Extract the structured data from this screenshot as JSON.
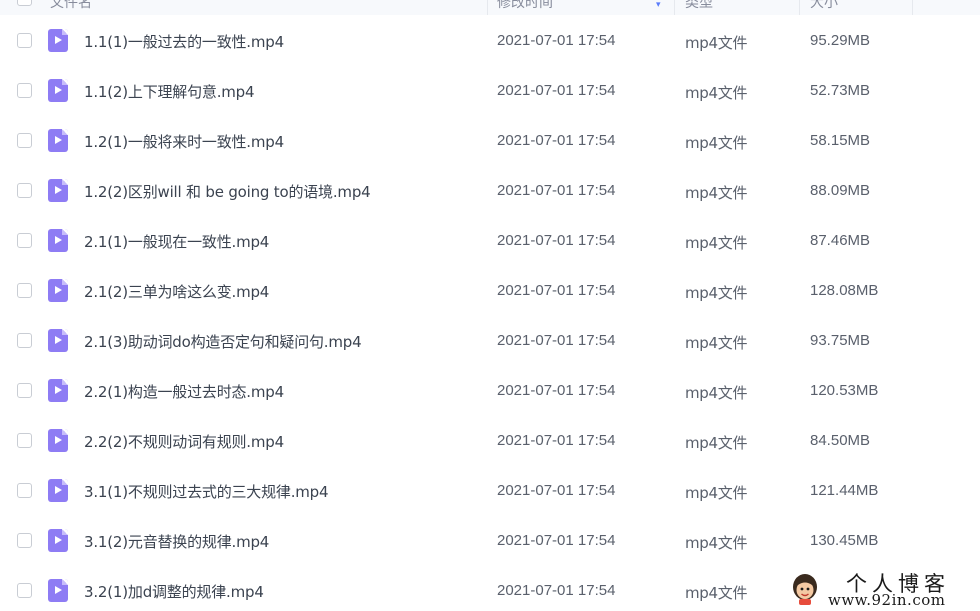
{
  "header": {
    "columns": [
      {
        "label": "文件名"
      },
      {
        "label": "修改时间"
      },
      {
        "label": "类型"
      },
      {
        "label": "大小"
      }
    ]
  },
  "files": [
    {
      "name": "1.1(1)一般过去的一致性.mp4",
      "modified": "2021-07-01 17:54",
      "type": "mp4文件",
      "size": "95.29MB"
    },
    {
      "name": "1.1(2)上下理解句意.mp4",
      "modified": "2021-07-01 17:54",
      "type": "mp4文件",
      "size": "52.73MB"
    },
    {
      "name": "1.2(1)一般将来时一致性.mp4",
      "modified": "2021-07-01 17:54",
      "type": "mp4文件",
      "size": "58.15MB"
    },
    {
      "name": "1.2(2)区别will 和 be going to的语境.mp4",
      "modified": "2021-07-01 17:54",
      "type": "mp4文件",
      "size": "88.09MB"
    },
    {
      "name": "2.1(1)一般现在一致性.mp4",
      "modified": "2021-07-01 17:54",
      "type": "mp4文件",
      "size": "87.46MB"
    },
    {
      "name": "2.1(2)三单为啥这么变.mp4",
      "modified": "2021-07-01 17:54",
      "type": "mp4文件",
      "size": "128.08MB"
    },
    {
      "name": "2.1(3)助动词do构造否定句和疑问句.mp4",
      "modified": "2021-07-01 17:54",
      "type": "mp4文件",
      "size": "93.75MB"
    },
    {
      "name": "2.2(1)构造一般过去时态.mp4",
      "modified": "2021-07-01 17:54",
      "type": "mp4文件",
      "size": "120.53MB"
    },
    {
      "name": "2.2(2)不规则动词有规则.mp4",
      "modified": "2021-07-01 17:54",
      "type": "mp4文件",
      "size": "84.50MB"
    },
    {
      "name": "3.1(1)不规则过去式的三大规律.mp4",
      "modified": "2021-07-01 17:54",
      "type": "mp4文件",
      "size": "121.44MB"
    },
    {
      "name": "3.1(2)元音替换的规律.mp4",
      "modified": "2021-07-01 17:54",
      "type": "mp4文件",
      "size": "130.45MB"
    },
    {
      "name": "3.2(1)加d调整的规律.mp4",
      "modified": "2021-07-01 17:54",
      "type": "mp4文件",
      "size": ""
    }
  ],
  "watermark": {
    "title": "个人博客",
    "url": "www.92in.com"
  },
  "icons": {
    "file_icon": "video-file-icon",
    "sort_icon": "sort-desc-icon"
  },
  "colors": {
    "file_icon": "#8e7cf4",
    "accent": "#5b7cfa",
    "header_bg": "#f7f9fc"
  }
}
